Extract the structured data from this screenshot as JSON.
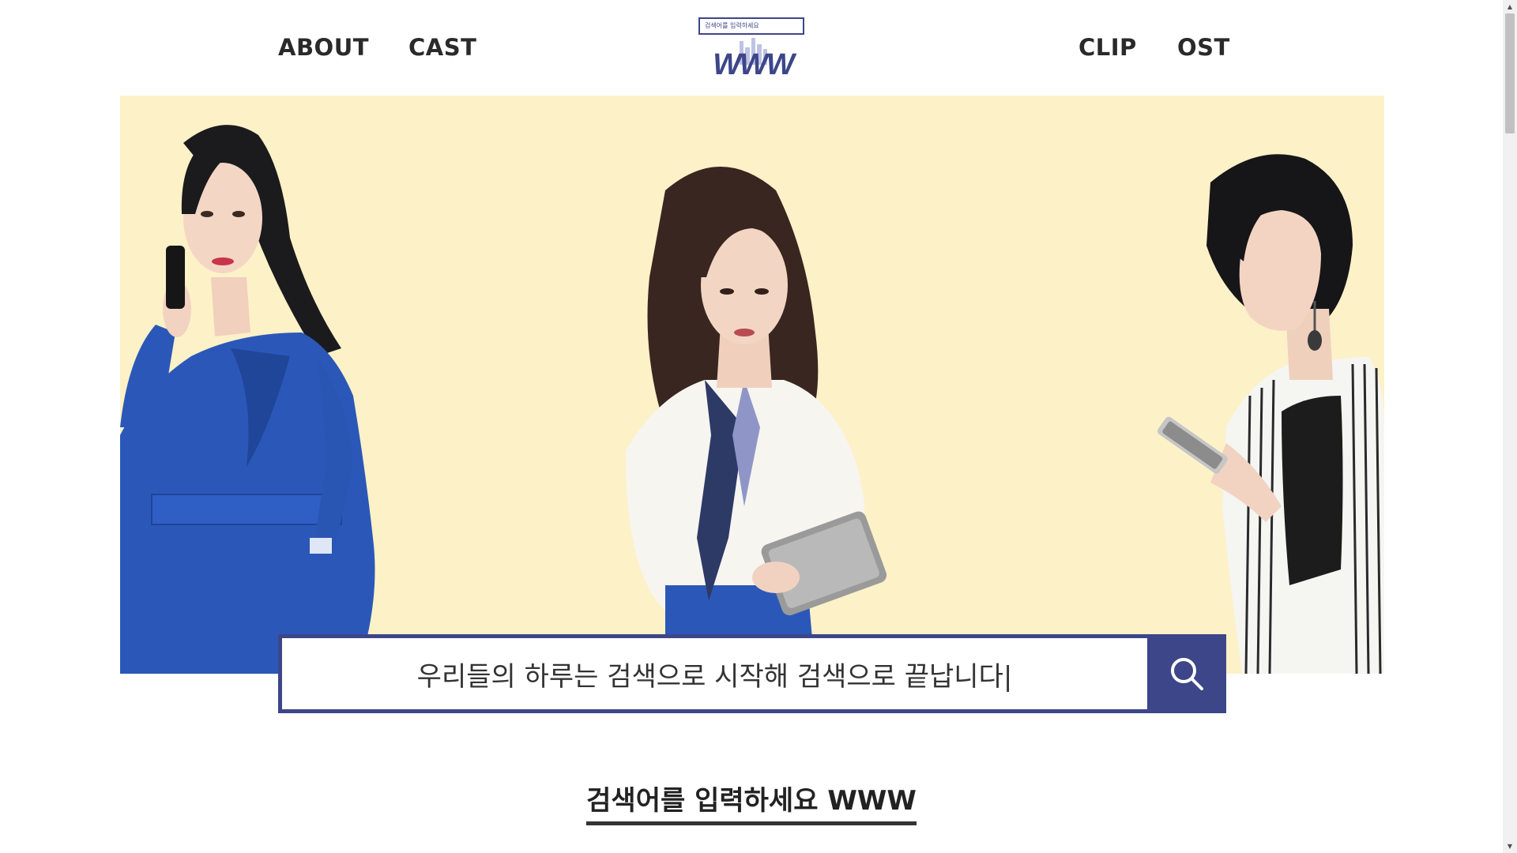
{
  "nav": {
    "left": [
      {
        "label": "ABOUT"
      },
      {
        "label": "CAST"
      }
    ],
    "right": [
      {
        "label": "CLIP"
      },
      {
        "label": "OST"
      }
    ]
  },
  "logo": {
    "search_text": "검색어를 입력하세요",
    "wordmark": "WWW"
  },
  "search": {
    "value": "우리들의 하루는 검색으로 시작해 검색으로 끝납니다|",
    "button_icon": "search-icon"
  },
  "section": {
    "title": "검색어를 입력하세요 WWW"
  },
  "colors": {
    "brand": "#3d4689",
    "hero_bg": "#fdf1c8",
    "text": "#2a2a2a"
  }
}
